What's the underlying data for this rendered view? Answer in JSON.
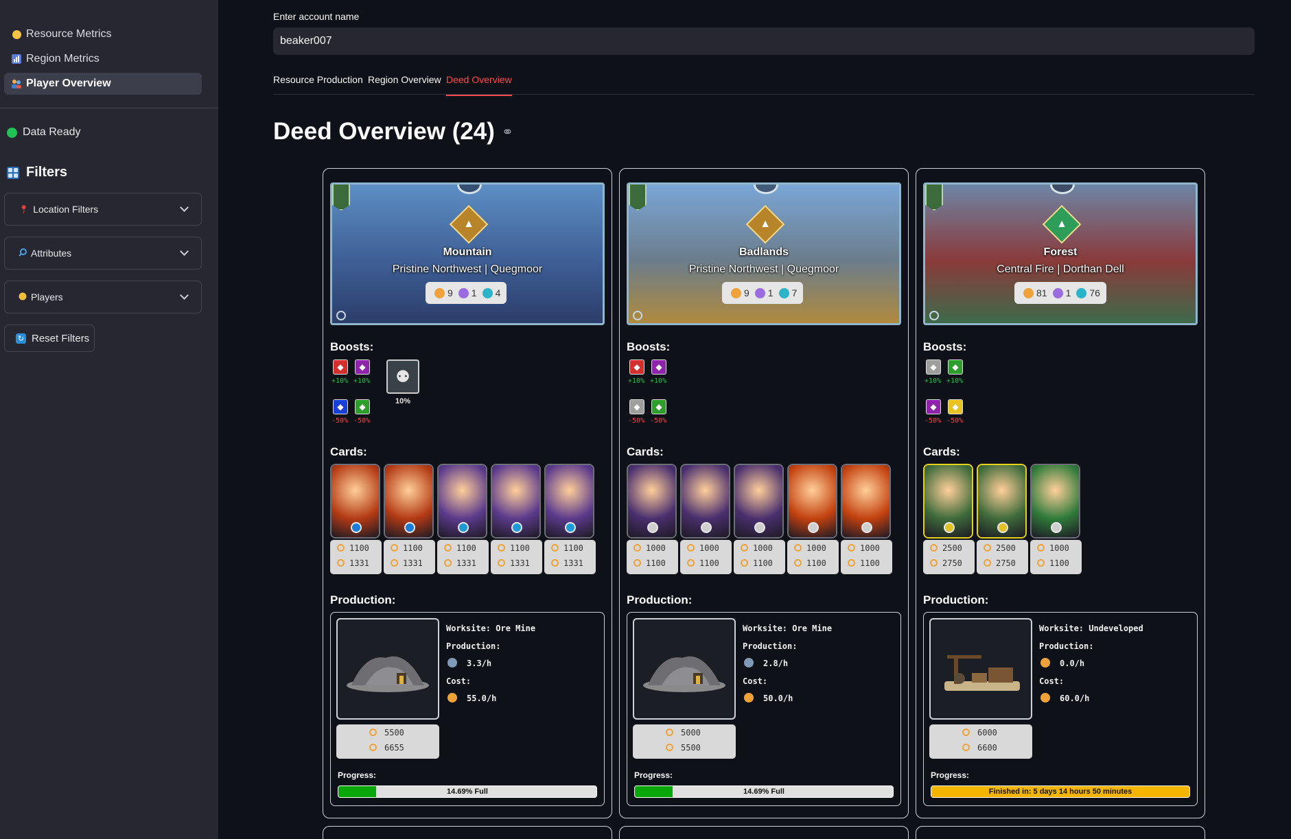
{
  "sidebar": {
    "nav": [
      {
        "label": "Resource Metrics",
        "icon": "yellow-circle-icon"
      },
      {
        "label": "Region Metrics",
        "icon": "bar-chart-icon"
      },
      {
        "label": "Player Overview",
        "icon": "people-icon"
      }
    ],
    "status": "Data Ready",
    "filters_title": "Filters",
    "expanders": [
      {
        "label": "Location Filters",
        "icon": "pin-icon"
      },
      {
        "label": "Attributes",
        "icon": "magnifier-icon"
      },
      {
        "label": "Players",
        "icon": "player-icon"
      }
    ],
    "reset_label": "Reset Filters"
  },
  "account": {
    "label": "Enter account name",
    "value": "beaker007"
  },
  "tabs": [
    {
      "label": "Resource Production",
      "active": false
    },
    {
      "label": "Region Overview",
      "active": false
    },
    {
      "label": "Deed Overview",
      "active": true
    }
  ],
  "page_title": "Deed Overview (24)",
  "deeds": [
    {
      "terrain": "Mountain",
      "region": "Pristine Northwest | Quegmoor",
      "stats": [
        "9",
        "1",
        "4"
      ],
      "boosts_label": "Boosts:",
      "boosts": [
        {
          "icon": "fire-icon",
          "color": "#d32f2f",
          "pct": "+10%",
          "kind": "plus"
        },
        {
          "icon": "death-icon",
          "color": "#8e24aa",
          "pct": "+10%",
          "kind": "plus"
        },
        {
          "icon": "water-icon",
          "color": "#1a3fd6",
          "pct": "-50%",
          "kind": "minus"
        },
        {
          "icon": "earth-icon",
          "color": "#2e9d2e",
          "pct": "-50%",
          "kind": "minus"
        }
      ],
      "totem_pct": "10%",
      "cards_label": "Cards:",
      "cards": [
        {
          "top": "1100",
          "bottom": "1331",
          "bg": "#b33a14",
          "orb": "#1e7bd6",
          "frame": "#6e6e78"
        },
        {
          "top": "1100",
          "bottom": "1331",
          "bg": "#b33a14",
          "orb": "#1e7bd6",
          "frame": "#6e6e78"
        },
        {
          "top": "1100",
          "bottom": "1331",
          "bg": "#5b3a8c",
          "orb": "#1e9bd6",
          "frame": "#6e6e78"
        },
        {
          "top": "1100",
          "bottom": "1331",
          "bg": "#5b3a8c",
          "orb": "#1e9bd6",
          "frame": "#6e6e78"
        },
        {
          "top": "1100",
          "bottom": "1331",
          "bg": "#5b3a8c",
          "orb": "#1e9bd6",
          "frame": "#6e6e78"
        }
      ],
      "production_label": "Production:",
      "worksite": "Worksite: Ore Mine",
      "prod_title": "Production:",
      "prod_value": "3.3/h",
      "prod_icon_color": "#7f9bb8",
      "cost_title": "Cost:",
      "cost_value": "55.0/h",
      "ws_top": "5500",
      "ws_bottom": "6655",
      "progress_label": "Progress:",
      "progress_text": "14.69% Full",
      "progress_fraction": 0.1469,
      "progress_color": "#0aa70a",
      "banner_colors": [
        "#5d8fc4",
        "#3e5f96",
        "#2b3d6a"
      ]
    },
    {
      "terrain": "Badlands",
      "region": "Pristine Northwest | Quegmoor",
      "stats": [
        "9",
        "1",
        "7"
      ],
      "boosts_label": "Boosts:",
      "boosts": [
        {
          "icon": "fire-icon",
          "color": "#d32f2f",
          "pct": "+10%",
          "kind": "plus"
        },
        {
          "icon": "death-icon",
          "color": "#8e24aa",
          "pct": "+10%",
          "kind": "plus"
        },
        {
          "icon": "neutral-icon",
          "color": "#9e9e9e",
          "pct": "-50%",
          "kind": "minus"
        },
        {
          "icon": "earth-icon",
          "color": "#2e9d2e",
          "pct": "-50%",
          "kind": "minus"
        }
      ],
      "totem_pct": "",
      "cards_label": "Cards:",
      "cards": [
        {
          "top": "1000",
          "bottom": "1100",
          "bg": "#4a2f6e",
          "orb": "#cfcfcf",
          "frame": "#6e6e78"
        },
        {
          "top": "1000",
          "bottom": "1100",
          "bg": "#4a2f6e",
          "orb": "#cfcfcf",
          "frame": "#6e6e78"
        },
        {
          "top": "1000",
          "bottom": "1100",
          "bg": "#4a2f6e",
          "orb": "#cfcfcf",
          "frame": "#6e6e78"
        },
        {
          "top": "1000",
          "bottom": "1100",
          "bg": "#c2410f",
          "orb": "#cfcfcf",
          "frame": "#6e6e78"
        },
        {
          "top": "1000",
          "bottom": "1100",
          "bg": "#c2410f",
          "orb": "#cfcfcf",
          "frame": "#6e6e78"
        }
      ],
      "production_label": "Production:",
      "worksite": "Worksite: Ore Mine",
      "prod_title": "Production:",
      "prod_value": "2.8/h",
      "prod_icon_color": "#7f9bb8",
      "cost_title": "Cost:",
      "cost_value": "50.0/h",
      "ws_top": "5000",
      "ws_bottom": "5500",
      "progress_label": "Progress:",
      "progress_text": "14.69% Full",
      "progress_fraction": 0.1469,
      "progress_color": "#0aa70a",
      "banner_colors": [
        "#7aa6d6",
        "#6b7d8c",
        "#b08a3e"
      ]
    },
    {
      "terrain": "Forest",
      "region": "Central Fire | Dorthan Dell",
      "stats": [
        "81",
        "1",
        "76"
      ],
      "boosts_label": "Boosts:",
      "boosts": [
        {
          "icon": "neutral-icon",
          "color": "#9e9e9e",
          "pct": "+10%",
          "kind": "plus"
        },
        {
          "icon": "earth-icon",
          "color": "#2e9d2e",
          "pct": "+10%",
          "kind": "plus"
        },
        {
          "icon": "death-icon",
          "color": "#8e24aa",
          "pct": "-50%",
          "kind": "minus"
        },
        {
          "icon": "life-icon",
          "color": "#e6c320",
          "pct": "-50%",
          "kind": "minus"
        }
      ],
      "totem_pct": "",
      "cards_label": "Cards:",
      "cards": [
        {
          "top": "2500",
          "bottom": "2750",
          "bg": "#3f6b3a",
          "orb": "#e0c22a",
          "frame": "#e6d21a"
        },
        {
          "top": "2500",
          "bottom": "2750",
          "bg": "#3f6b3a",
          "orb": "#e0c22a",
          "frame": "#e6d21a"
        },
        {
          "top": "1000",
          "bottom": "1100",
          "bg": "#2f7a3a",
          "orb": "#cfcfcf",
          "frame": "#6e6e78"
        }
      ],
      "production_label": "Production:",
      "worksite": "Worksite: Undeveloped",
      "prod_title": "Production:",
      "prod_value": "0.0/h",
      "prod_icon_color": "#f0a23a",
      "cost_title": "Cost:",
      "cost_value": "60.0/h",
      "ws_top": "6000",
      "ws_bottom": "6600",
      "progress_label": "Progress:",
      "progress_text": "Finished in: 5 days 14 hours 50 minutes",
      "progress_fraction": 1.0,
      "progress_color": "#f5b400",
      "banner_colors": [
        "#6d85a6",
        "#8a3a3a",
        "#3e6a4a"
      ]
    }
  ]
}
